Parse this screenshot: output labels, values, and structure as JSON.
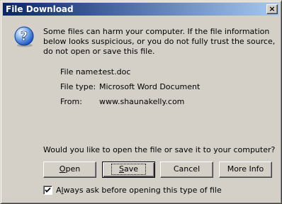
{
  "window": {
    "title": "File Download",
    "close_glyph": "×"
  },
  "icons": {
    "dialog_icon": "question-icon",
    "dialog_icon_glyph": "?",
    "check_glyph": "✔",
    "accent_color": "#0a246a",
    "icon_color": "#1c58c4"
  },
  "message": {
    "warning": "Some files can harm your computer. If the file information below looks suspicious, or you do not fully trust the source, do not open or save this file.",
    "question": "Would you like to open the file or save it to your computer?"
  },
  "file_info": {
    "name_label": "File name:",
    "name_value": "test.doc",
    "type_label": "File type:",
    "type_value": "Microsoft Word Document",
    "from_label": "From:",
    "from_value": "www.shaunakelly.com"
  },
  "buttons": {
    "open_mnemonic": "O",
    "open_rest": "pen",
    "save_mnemonic": "S",
    "save_rest": "ave",
    "cancel": "Cancel",
    "more_info": "More Info"
  },
  "checkbox": {
    "checked": true,
    "label_mnemonic": "l",
    "label_prefix": "A",
    "label_rest": "ways ask before opening this type of file"
  }
}
